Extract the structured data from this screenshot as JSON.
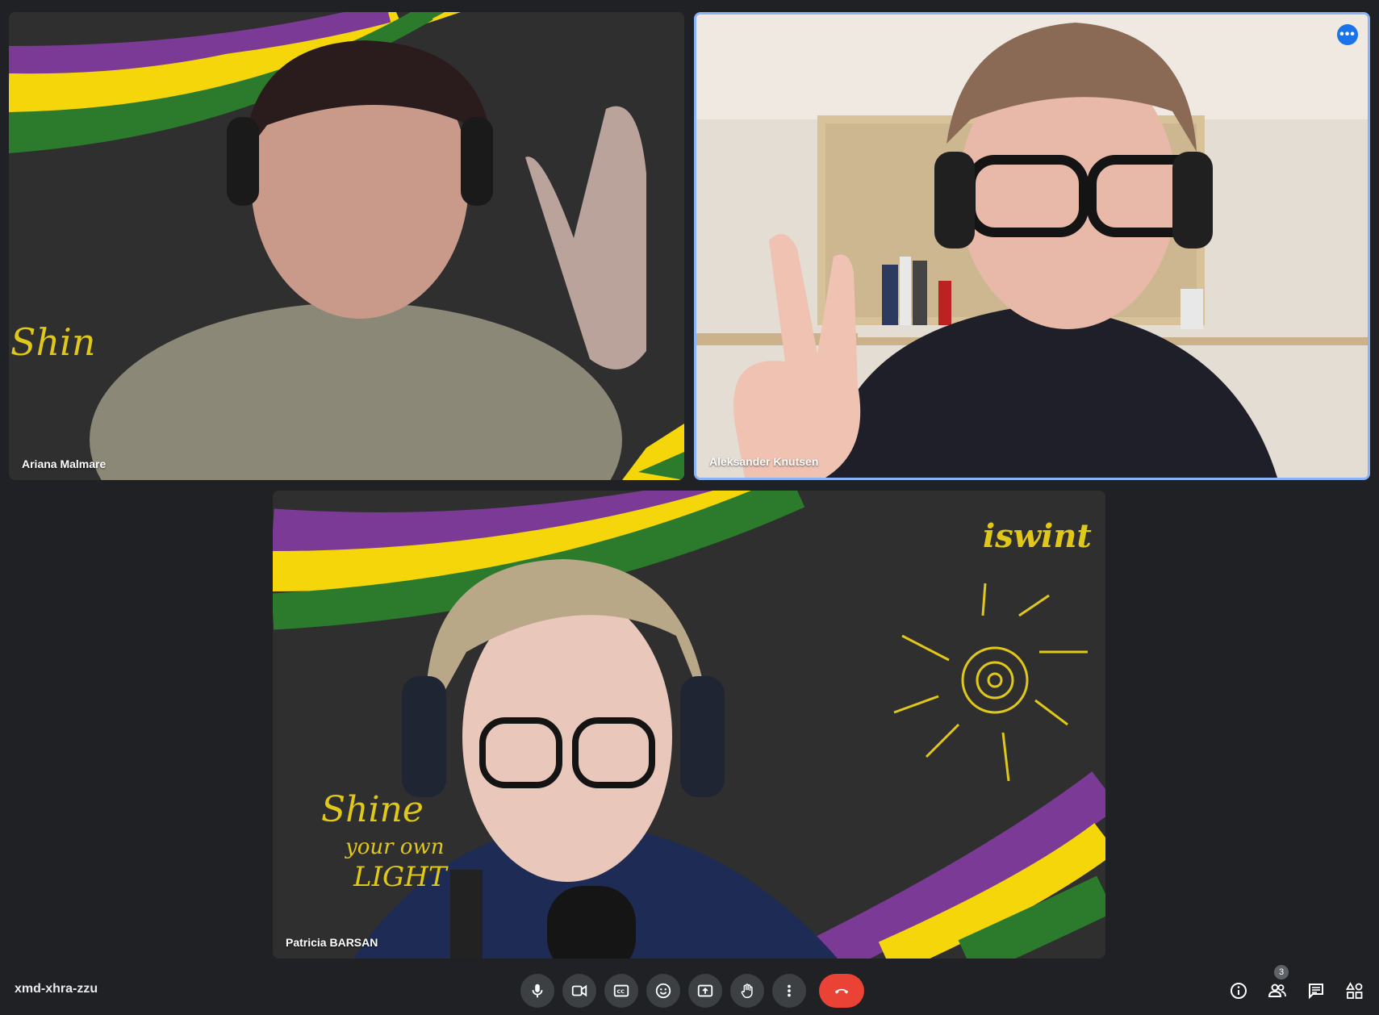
{
  "participants": [
    {
      "name": "Ariana Malmare"
    },
    {
      "name": "Aleksander Knutsen",
      "more_options": "•••"
    },
    {
      "name": "Patricia BARSAN"
    }
  ],
  "meeting": {
    "code": "xmd-xhra-zzu"
  },
  "controls": [
    {
      "icon": "microphone-icon"
    },
    {
      "icon": "camera-icon"
    },
    {
      "icon": "captions-icon"
    },
    {
      "icon": "emoji-reaction-icon"
    },
    {
      "icon": "present-screen-icon"
    },
    {
      "icon": "raise-hand-icon"
    },
    {
      "icon": "more-options-icon"
    },
    {
      "icon": "end-call-icon"
    }
  ],
  "right_panel": {
    "people_count": "3",
    "icons": [
      "info-icon",
      "people-icon",
      "chat-icon",
      "activities-icon"
    ]
  },
  "colors": {
    "background": "#202124",
    "control_button": "#3c4043",
    "end_call": "#ea4335",
    "active_speaker_border": "#8ab4f8",
    "stripe_purple": "#7b3a96",
    "stripe_yellow": "#f5d60a",
    "stripe_green": "#2c7a2c"
  }
}
